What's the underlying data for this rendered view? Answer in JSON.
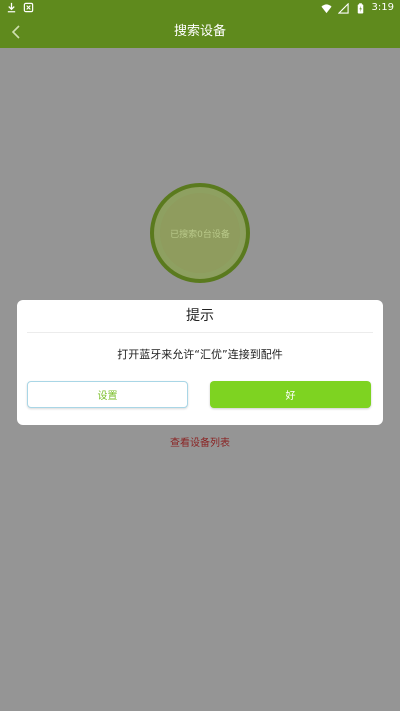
{
  "status_bar": {
    "time": "3:19",
    "left_icons": [
      "download-icon",
      "notification-icon"
    ],
    "right_icons": [
      "wifi-icon",
      "signal-icon",
      "battery-icon"
    ]
  },
  "header": {
    "title": "搜索设备",
    "back_icon": "chevron-left-icon"
  },
  "search": {
    "status_text": "已搜索0台设备",
    "device_list_link": "查看设备列表"
  },
  "dialog": {
    "title": "提示",
    "message": "打开蓝牙来允许“汇优”连接到配件",
    "settings_label": "设置",
    "ok_label": "好"
  },
  "colors": {
    "primary": "#5f8a1d",
    "accent_green": "#7ed321",
    "link_red": "#8a2323",
    "overlay_gray": "#959595"
  }
}
